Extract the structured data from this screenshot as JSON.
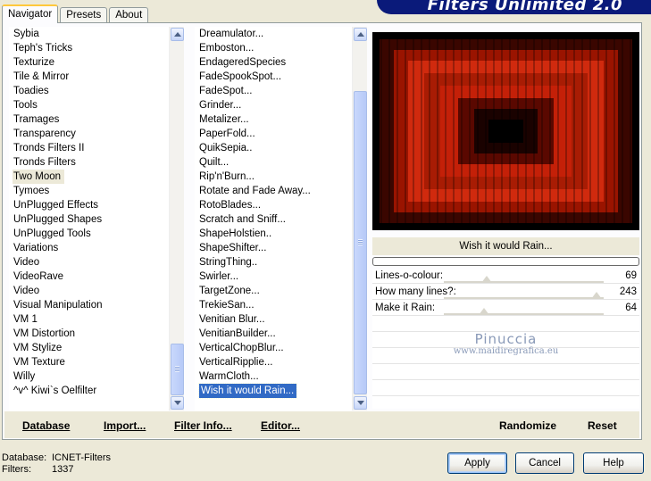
{
  "tabs": [
    {
      "label": "Navigator"
    },
    {
      "label": "Presets"
    },
    {
      "label": "About"
    }
  ],
  "banner": {
    "title": "Filters Unlimited 2.0",
    "color": "#0a1a7a"
  },
  "categories": {
    "items": [
      "Sybia",
      "Teph's Tricks",
      "Texturize",
      "Tile & Mirror",
      "Toadies",
      "Tools",
      "Tramages",
      "Transparency",
      "Tronds Filters II",
      "Tronds Filters",
      "Two Moon",
      "Tymoes",
      "UnPlugged Effects",
      "UnPlugged Shapes",
      "UnPlugged Tools",
      "Variations",
      "Video",
      "VideoRave",
      "Video",
      "Visual Manipulation",
      "VM 1",
      "VM Distortion",
      "VM Stylize",
      "VM Texture",
      "Willy",
      "^v^ Kiwi`s Oelfilter"
    ],
    "selected": "Two Moon"
  },
  "filters": {
    "items": [
      "Dreamulator...",
      "Emboston...",
      "EndageredSpecies",
      "FadeSpookSpot...",
      "FadeSpot...",
      "Grinder...",
      "Metalizer...",
      "PaperFold...",
      "QuikSepia..",
      "Quilt...",
      "Rip'n'Burn...",
      "Rotate and Fade Away...",
      "RotoBlades...",
      "Scratch and Sniff...",
      "ShapeHolstien..",
      "ShapeShifter...",
      "StringThing..",
      "Swirler...",
      "TargetZone...",
      "TrekieSan...",
      "Venitian Blur...",
      "VenitianBuilder...",
      "VerticalChopBlur...",
      "VerticalRipplie...",
      "WarmCloth...",
      "Wish it would Rain..."
    ],
    "selected": "Wish it would Rain..."
  },
  "preview": {
    "filter_name": "Wish it would Rain..."
  },
  "controls": [
    {
      "label": "Lines-o-colour:",
      "value": "69",
      "level": 69
    },
    {
      "label": "How many lines?:",
      "value": "243",
      "level": 243
    },
    {
      "label": "Make it Rain:",
      "value": "64",
      "level": 64
    }
  ],
  "watermark": {
    "name": "Pinuccia",
    "url": "www.maidiregrafica.eu"
  },
  "toolbar": {
    "database": "Database",
    "import": "Import...",
    "filter_info": "Filter Info...",
    "editor": "Editor...",
    "randomize": "Randomize",
    "reset": "Reset"
  },
  "status": {
    "database_label": "Database:",
    "database_value": "ICNET-Filters",
    "filters_label": "Filters:",
    "filters_value": "1337"
  },
  "buttons": {
    "apply": "Apply",
    "cancel": "Cancel",
    "help": "Help"
  },
  "colors": {
    "selection": "#316ac5",
    "preview_red": "#c8200c",
    "accent_tab": "#ffc83c"
  }
}
